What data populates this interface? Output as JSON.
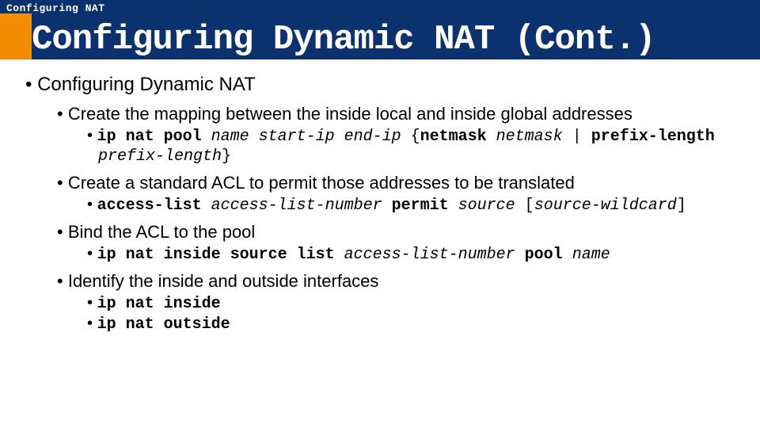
{
  "header": {
    "small": "Configuring NAT",
    "title": "Configuring Dynamic NAT (Cont.)"
  },
  "lvl1_0": "Configuring Dynamic NAT",
  "lvl2_0": "Create the mapping between the inside local and inside global addresses",
  "lvl3_0_0_a": "ip nat pool",
  "lvl3_0_0_b": " name start-ip end-ip",
  "lvl3_0_0_c": " {",
  "lvl3_0_0_d": "netmask",
  "lvl3_0_0_e": " netmask",
  "lvl3_0_0_f": " |",
  "lvl3_0_0_g": " prefix-length",
  "lvl3_0_0_h": " prefix-length",
  "lvl3_0_0_i": "}",
  "lvl2_1": "Create a standard ACL to permit those addresses to be translated",
  "lvl3_1_0_a": "access-list",
  "lvl3_1_0_b": " access-list-number",
  "lvl3_1_0_c": " permit",
  "lvl3_1_0_d": " source",
  "lvl3_1_0_e": " [",
  "lvl3_1_0_f": "source-wildcard",
  "lvl3_1_0_g": "]",
  "lvl2_2": "Bind the ACL to the pool",
  "lvl3_2_0_a": "ip nat inside source list",
  "lvl3_2_0_b": " access-list-number",
  "lvl3_2_0_c": " pool",
  "lvl3_2_0_d": " name",
  "lvl2_3": "Identify the inside and outside interfaces",
  "lvl3_3_0": "ip nat inside",
  "lvl3_3_1": "ip nat outside"
}
